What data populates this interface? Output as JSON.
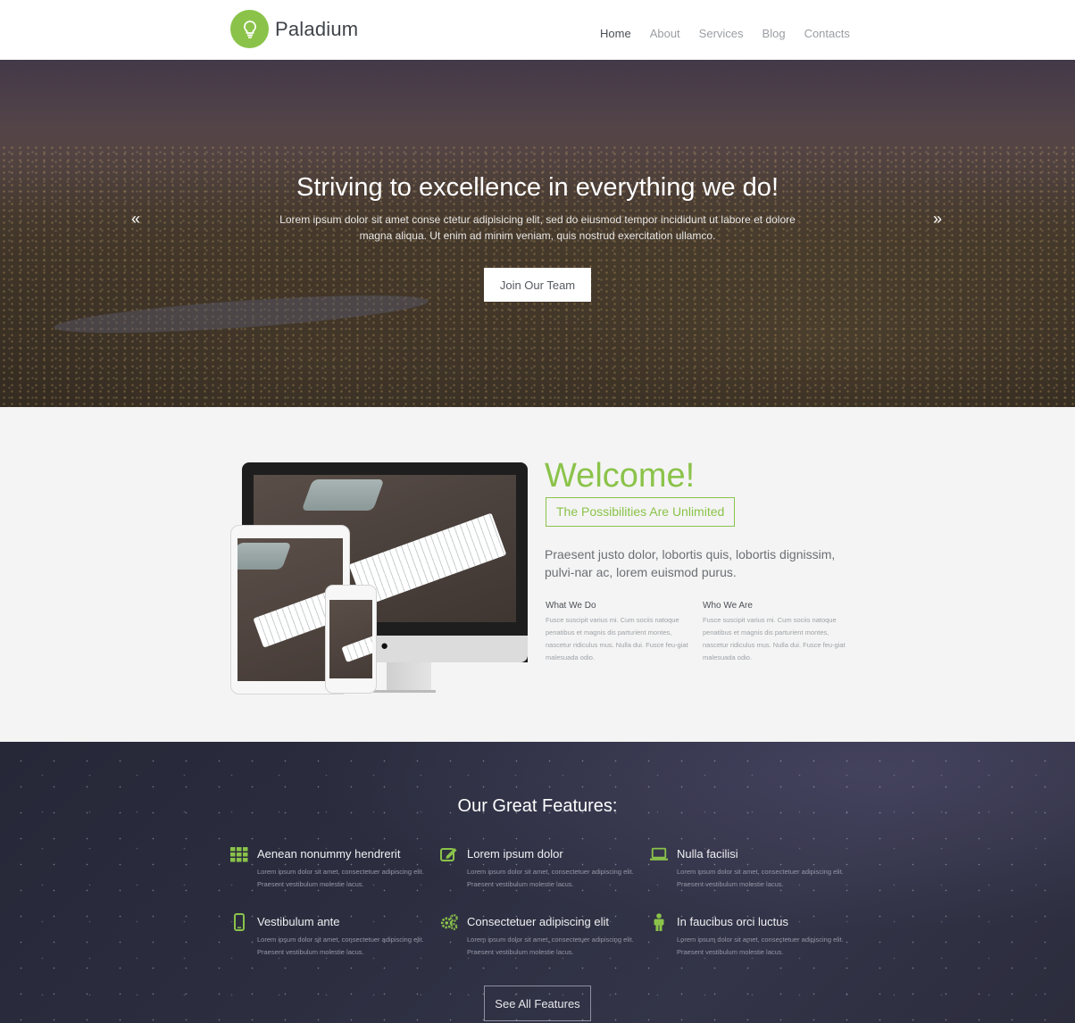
{
  "brand": {
    "name": "Paladium",
    "accent": "#8bc34a",
    "logo_icon": "lightbulb-icon"
  },
  "nav": {
    "items": [
      {
        "label": "Home",
        "active": true
      },
      {
        "label": "About",
        "active": false
      },
      {
        "label": "Services",
        "active": false
      },
      {
        "label": "Blog",
        "active": false
      },
      {
        "label": "Contacts",
        "active": false
      }
    ]
  },
  "hero": {
    "title": "Striving to excellence in everything we do!",
    "text": "Lorem ipsum dolor sit amet conse ctetur adipisicing elit, sed do eiusmod tempor incididunt ut labore et dolore magna aliqua. Ut enim ad minim veniam, quis nostrud exercitation ullamco.",
    "prev_icon": "«",
    "next_icon": "»",
    "button_label": "Join Our Team"
  },
  "welcome": {
    "title": "Welcome!",
    "tagline": "The Possibilities Are Unlimited",
    "lead": "Praesent justo dolor, lobortis quis, lobortis dignissim, pulvi-nar ac, lorem euismod purus.",
    "columns": [
      {
        "title": "What We Do",
        "text": "Fusce suscipit varius mi. Cum sociis natoque penatibus et magnis dis parturient montes, nascetur ridiculus mus. Nulla dui. Fusce feu-giat malesuada odio."
      },
      {
        "title": "Who We Are",
        "text": "Fusce suscipit varius mi. Cum sociis natoque penatibus et magnis dis parturient montes, nascetur ridiculus mus. Nulla dui. Fusce feu-giat malesuada odio."
      }
    ]
  },
  "features": {
    "title": "Our Great Features:",
    "items": [
      {
        "icon": "grid-icon",
        "title": "Aenean nonummy hendrerit",
        "text": "Lorem ipsum dolor sit amet, consectetuer adipiscing elit. Praesent vestibulum molestie lacus."
      },
      {
        "icon": "edit-icon",
        "title": "Lorem ipsum dolor",
        "text": "Lorem ipsum dolor sit amet, consectetuer adipiscing elit. Praesent vestibulum molestie lacus."
      },
      {
        "icon": "laptop-icon",
        "title": "Nulla facilisi",
        "text": "Lorem ipsum dolor sit amet, consectetuer adipiscing elit. Praesent vestibulum molestie lacus."
      },
      {
        "icon": "mobile-icon",
        "title": "Vestibulum ante",
        "text": "Lorem ipsum dolor sit amet, consectetuer adipiscing elit. Praesent vestibulum molestie lacus."
      },
      {
        "icon": "gears-icon",
        "title": "Consectetuer adipiscing elit",
        "text": "Lorem ipsum dolor sit amet, consectetuer adipiscing elit. Praesent vestibulum molestie lacus."
      },
      {
        "icon": "person-icon",
        "title": "In faucibus orci luctus",
        "text": "Lorem ipsum dolor sit amet, consectetuer adipiscing elit. Praesent vestibulum molestie lacus."
      }
    ],
    "button_label": "See All Features"
  }
}
